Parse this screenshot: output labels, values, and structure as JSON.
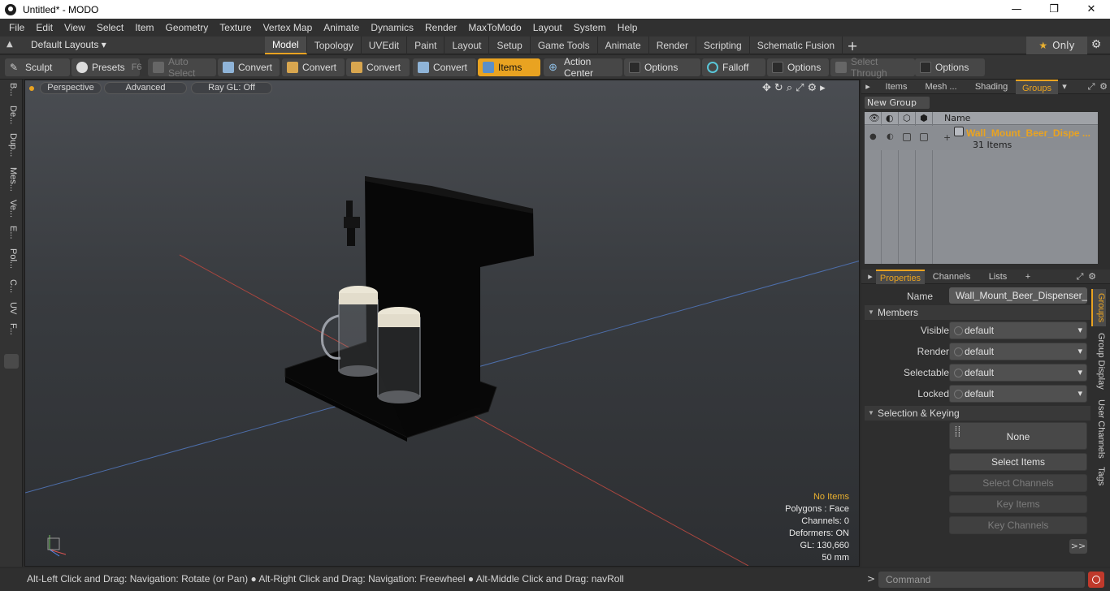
{
  "window": {
    "title": "Untitled* - MODO",
    "minimize": "—",
    "maximize": "❐",
    "close": "✕"
  },
  "menu": [
    "File",
    "Edit",
    "View",
    "Select",
    "Item",
    "Geometry",
    "Texture",
    "Vertex Map",
    "Animate",
    "Dynamics",
    "Render",
    "MaxToModo",
    "Layout",
    "System",
    "Help"
  ],
  "layouts": {
    "selector": "Default Layouts ▾",
    "tabs": [
      "Model",
      "Topology",
      "UVEdit",
      "Paint",
      "Layout",
      "Setup",
      "Game Tools",
      "Animate",
      "Render",
      "Scripting",
      "Schematic Fusion"
    ],
    "active_tab": "Model",
    "add": "+",
    "only": "Only"
  },
  "toolbar": {
    "sculpt": "Sculpt",
    "presets": "Presets",
    "presets_key": "F6",
    "auto_select": "Auto Select",
    "convert1": "Convert",
    "convert2": "Convert",
    "convert3": "Convert",
    "convert4": "Convert",
    "items": "Items",
    "action_center": "Action Center",
    "options1": "Options",
    "falloff": "Falloff",
    "options2": "Options",
    "select_through": "Select Through",
    "options3": "Options"
  },
  "left_tabs": [
    "B...",
    "De...",
    "Dup...",
    "Mes...",
    "Ve...",
    "E...",
    "Pol...",
    "C...",
    "UV",
    "F..."
  ],
  "viewport": {
    "view": "Perspective",
    "shading": "Advanced",
    "raygl": "Ray GL: Off",
    "info": {
      "no_items": "No Items",
      "polygons": "Polygons : Face",
      "channels": "Channels: 0",
      "deformers": "Deformers: ON",
      "gl": "GL: 130,660",
      "scale": "50 mm"
    }
  },
  "status": "Alt-Left Click and Drag: Navigation: Rotate (or Pan) ● Alt-Right Click and Drag: Navigation: Freewheel ● Alt-Middle Click and Drag: navRoll",
  "top_panel": {
    "tabs": [
      "Items",
      "Mesh ...",
      "Shading",
      "Groups"
    ],
    "active_tab": "Groups",
    "new_group": "New Group",
    "col_name": "Name",
    "group_name": "Wall_Mount_Beer_Dispe ...",
    "group_count": "31 Items"
  },
  "properties": {
    "tabs": [
      "Properties",
      "Channels",
      "Lists"
    ],
    "add": "+",
    "name_label": "Name",
    "name_value": "Wall_Mount_Beer_Dispenser_wit",
    "members": "Members",
    "visible_label": "Visible",
    "visible_value": "default",
    "render_label": "Render",
    "render_value": "default",
    "selectable_label": "Selectable",
    "selectable_value": "default",
    "locked_label": "Locked",
    "locked_value": "default",
    "selection_keying": "Selection & Keying",
    "none": "None",
    "select_items": "Select Items",
    "select_channels": "Select Channels",
    "key_items": "Key Items",
    "key_channels": "Key Channels",
    "more": ">>",
    "side_tabs": [
      "Groups",
      "Group Display",
      "User Channels",
      "Tags"
    ]
  },
  "command": {
    "prompt": ">",
    "placeholder": "Command"
  },
  "colors": {
    "accent": "#e9a321",
    "viewport_top": "#4a4d52",
    "viewport_bottom": "#2d2f32"
  }
}
